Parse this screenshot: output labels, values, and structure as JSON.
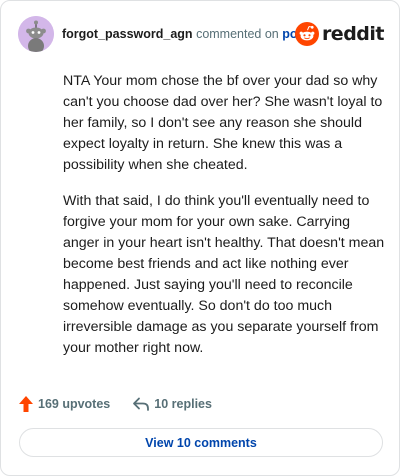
{
  "comment": {
    "username": "forgot_password_agn",
    "action_text": "commented on",
    "post_link_label": "post",
    "brand_name": "reddit",
    "paragraphs": [
      "NTA Your mom chose the bf over your dad so why can't you choose dad over her? She wasn't loyal to her family, so I don't see any reason she should expect loyalty in return. She knew this was a possibility when she cheated.",
      "With that said, I do think you'll eventually need to forgive your mom for your own sake. Carrying anger in your heart isn't healthy. That doesn't mean become best friends and act like nothing ever happened. Just saying you'll need to reconcile somehow eventually. So don't do too much irreversible damage as you separate yourself from your mother right now."
    ],
    "upvotes_label": "169 upvotes",
    "replies_label": "10 replies",
    "view_comments_label": "View 10 comments"
  },
  "colors": {
    "upvote_arrow": "#ff4500",
    "link_blue": "#0045ac",
    "avatar_bg": "#d3b7e9",
    "muted_text": "#576f76",
    "border": "#dfe1e3"
  },
  "icons": {
    "avatar": "snoo-avatar-icon",
    "brand_logo": "reddit-logo-icon",
    "upvote": "upvote-arrow-icon",
    "reply": "reply-arrow-icon"
  }
}
